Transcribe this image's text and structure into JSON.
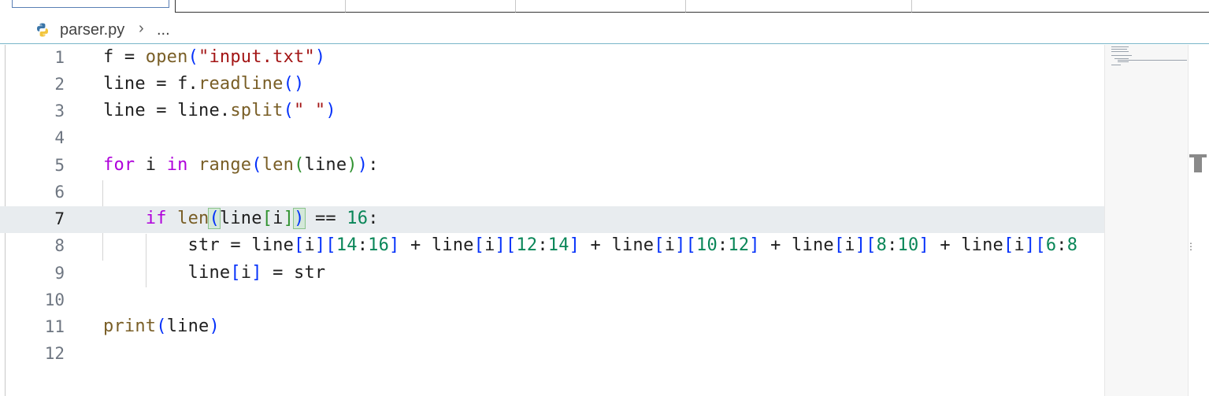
{
  "breadcrumb": {
    "file": "parser.py",
    "separator": "›",
    "more": "..."
  },
  "editor": {
    "line_numbers": [
      "1",
      "2",
      "3",
      "4",
      "5",
      "6",
      "7",
      "8",
      "9",
      "10",
      "11",
      "12"
    ],
    "current_line": "7",
    "lines": [
      "f = open(\"input.txt\")",
      "line = f.readline()",
      "line = line.split(\" \")",
      "",
      "for i in range(len(line)):",
      "",
      "    if len(line[i]) == 16:",
      "        str = line[i][14:16] + line[i][12:14] + line[i][10:12] + line[i][8:10] + line[i][6:8",
      "        line[i] = str",
      "",
      "print(line)",
      ""
    ]
  },
  "icons": {
    "file_icon": "python-icon",
    "overflow": "vertical-ellipsis-icon"
  },
  "colors": {
    "keyword": "#af00db",
    "function": "#795e26",
    "string": "#a31515",
    "number": "#098658",
    "current_line_bg": "#e8ecef",
    "breadcrumb_border": "#79b6c9"
  }
}
